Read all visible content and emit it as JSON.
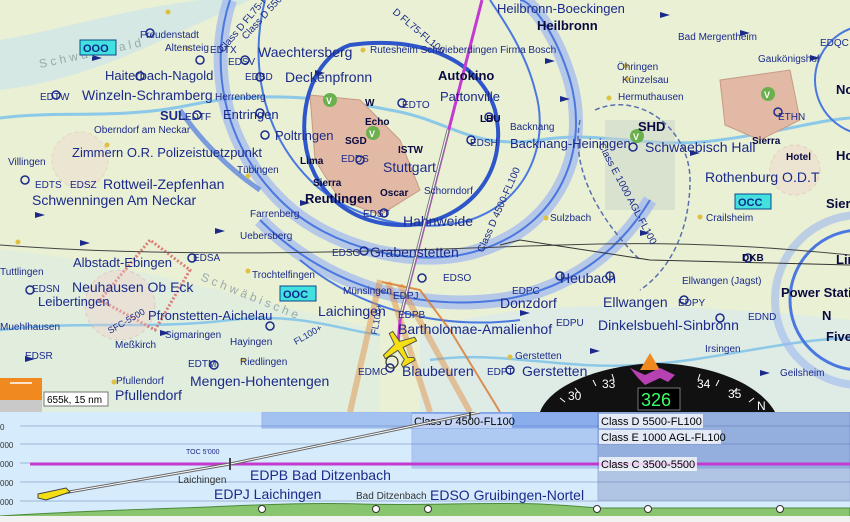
{
  "places": {
    "freudenstadt": "Freudenstadt",
    "altensteig": "Altensteig",
    "haiterbach": "Haiterbach-Nagold",
    "winzeln": "Winzeln-Schramberg",
    "herrenberg": "Herrenberg",
    "sul": "SUL",
    "edtf": "EDTF",
    "edtx": "EDTX",
    "edtw": "EDTW",
    "oberndorf": "Oberndorf am Neckar",
    "zimmern": "Zimmern O.R. Polizeistuetzpunkt",
    "tubingen": "Tübingen",
    "villingen": "Villingen",
    "edts": "EDTS",
    "edsz": "EDSZ",
    "rottweil": "Rottweil-Zepfenhan",
    "schwenningen": "Schwenningen Am Neckar",
    "entringen": "Entringen",
    "poltringen": "Poltringen",
    "lima": "Lima",
    "eddsl": "EDDS",
    "sierra": "Sierra",
    "reutlingen": "Reutlingen",
    "edst": "EDST",
    "farrenberg": "Farrenberg",
    "uebersberg": "Uebersberg",
    "edsa": "EDSA",
    "trochtelfingen": "Trochtelfingen",
    "albstadt": "Albstadt-Ebingen",
    "neuhausen": "Neuhausen Ob Eck",
    "leibertingen": "Leibertingen",
    "edsn": "EDSN",
    "tuttlingen": "Tuttlingen",
    "muehlhausen": "Muehlhausen",
    "pfronstetten": "Pfronstetten-Aichelau",
    "sigmaringen": "Sigmaringen",
    "messkirch": "Meßkirch",
    "hayingen": "Hayingen",
    "edsr": "EDSR",
    "riedlingen": "Riedlingen",
    "edtm": "EDTM",
    "mengen": "Mengen-Hohentengen",
    "pfullendorf_s": "Pfullendorf",
    "pfullendorf_b": "Pfullendorf",
    "waechtersberg": "Waechtersberg",
    "edsv": "EDSV",
    "edsd": "EDSD",
    "deckenpfronn": "Deckenpfronn",
    "rutesheim": "Rutesheim Schwieberdingen Firma Bosch",
    "autokino": "Autokino",
    "edto": "EDTO",
    "pattonville": "Pattonville",
    "w": "W",
    "echo": "Echo",
    "sgd": "SGD",
    "istw": "ISTW",
    "stuttgart": "Stuttgart",
    "oscar": "Oscar",
    "schorndorf": "Schorndorf",
    "hahnweide": "Hahnweide",
    "lbu": "LBU",
    "backnang": "Backnang",
    "backnang_h": "Backnang-Heiningen",
    "edsh": "EDSH",
    "edsg": "EDSG",
    "grabenstetten": "Grabenstetten",
    "edso": "EDSO",
    "muensingen": "Münsingen",
    "laichingen": "Laichingen",
    "edpj": "EDPJ",
    "edpb": "EDPB",
    "bartholomae": "Bartholomae-Amalienhof",
    "edpc": "EDPC",
    "donzdorf": "Donzdorf",
    "edpu": "EDPU",
    "heubach": "Heubach",
    "edmc": "EDMC",
    "blaubeuren": "Blaubeuren",
    "edpt": "EDPT",
    "gerstetten_s": "Gerstetten",
    "gerstetten": "Gerstetten",
    "heilbronn_b": "Heilbronn-Boeckingen",
    "heilbronn": "Heilbronn",
    "bad_mergentheim": "Bad Mergentheim",
    "gaukoenigshofen": "Gaukönigshof",
    "edqc": "EDQC",
    "oehringen": "Öhringen",
    "kuenzelsau": "Künzelsau",
    "hermuthausen": "Hermuthausen",
    "shd": "SHD",
    "schwaebisch_hall": "Schwaebisch Hall",
    "ethn": "ETHN",
    "sierra2": "Sierra",
    "hotel": "Hotel",
    "rothenburg": "Rothenburg O.D.T",
    "crailsheim": "Crailsheim",
    "sulzbach": "Sulzbach",
    "ellwangen_j": "Ellwangen (Jagst)",
    "dkb": "DKB",
    "ellwangen": "Ellwangen",
    "edpy": "EDPY",
    "dinkelsbuehl": "Dinkelsbuehl-Sinbronn",
    "ednd": "EDND",
    "irsingen": "Irsingen",
    "geilsheim": "Geilsheim",
    "power_station": "Power Station",
    "five": "Five",
    "n_e": "N",
    "sierr": "Sierr",
    "lir": "Lir",
    "no": "No",
    "hotel_b": "Ho",
    "schwarzwald": "S c h w a r z w a l d",
    "schwaebische_alb": "S c h w ä b i s c h e"
  },
  "airspace_labels": {
    "class_d_a": "Class D FL75-FL100",
    "class_d_b": "Class D 5500-FL",
    "class_d_c": "D FL75-FL100",
    "class_d_4500": "Class D 4500-FL100",
    "class_e_1000": "Class E 1000 AGL-FL100",
    "fl100_a": "FL100+",
    "fl100_b": "FL100+",
    "sfc": "SFC-5500"
  },
  "ooo_boxes": [
    "OOO",
    "OOC",
    "OCC"
  ],
  "scale_text": "655k, 15 nm",
  "compass": {
    "heading": "326",
    "tick_30": "30",
    "tick_33": "33",
    "tick_34": "34",
    "tick_35": "35",
    "tick_n": "N"
  },
  "profile": {
    "alt_ticks": [
      "0",
      "000",
      "000",
      "000",
      "000"
    ],
    "airspaces": [
      "Class D 4500-FL100",
      "Class D 5500-FL100",
      "Class E 1000 AGL-FL100",
      "Class C 3500-5500"
    ],
    "toc": "TOC 5'000",
    "laichingen_small": "Laichingen",
    "edpb": "EDPB Bad Ditzenbach",
    "edpj": "EDPJ Laichingen",
    "bad_ditzenbach_small": "Bad Ditzenbach",
    "edso": "EDSO Gruibingen-Nortel"
  },
  "colors": {
    "map_bg": "#e9f0d4",
    "water": "#a9d6ee",
    "airspace_blue": "#4a78e0",
    "route_magenta": "#c23ad0",
    "profile_sky": "#d6ebfb",
    "heading_green": "#3bff6a",
    "plane_yellow": "#f4e012"
  }
}
